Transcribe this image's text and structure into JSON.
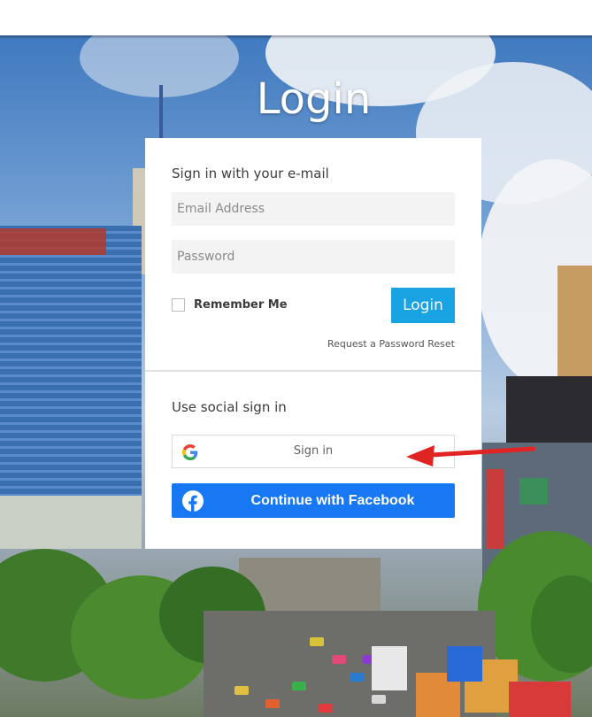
{
  "page": {
    "title": "Login"
  },
  "email_form": {
    "heading": "Sign in with your e-mail",
    "email_placeholder": "Email Address",
    "password_placeholder": "Password",
    "remember_label": "Remember Me",
    "login_label": "Login",
    "reset_link": "Request a Password Reset"
  },
  "social": {
    "heading": "Use social sign in",
    "google_label": "Sign in",
    "facebook_label": "Continue with Facebook"
  },
  "icons": {
    "google": "google-g-icon",
    "facebook": "facebook-f-icon",
    "annotation": "red-arrow-annotation"
  },
  "colors": {
    "login_button": "#1aa3e2",
    "facebook_button": "#1877f2",
    "annotation_arrow": "#e02424"
  }
}
